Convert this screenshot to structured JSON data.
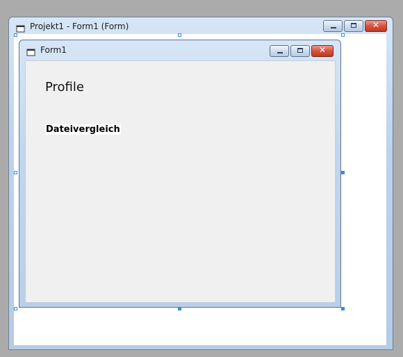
{
  "outer_window": {
    "title": "Projekt1 - Form1 (Form)",
    "icon": "form-icon",
    "buttons": {
      "minimize": "minimize-icon",
      "maximize": "maximize-icon",
      "close": "close-icon",
      "close_glyph": "✕"
    }
  },
  "inner_window": {
    "title": "Form1",
    "icon": "form-icon",
    "buttons": {
      "minimize": "minimize-icon",
      "maximize": "maximize-icon",
      "close": "close-icon",
      "close_glyph": "✕"
    }
  },
  "form": {
    "profile_label": "Profile",
    "compare_label": "Dateivergleich"
  },
  "colors": {
    "desktop": "#ababab",
    "handle": "#3a8fd6",
    "close_button": "#d4533e"
  }
}
